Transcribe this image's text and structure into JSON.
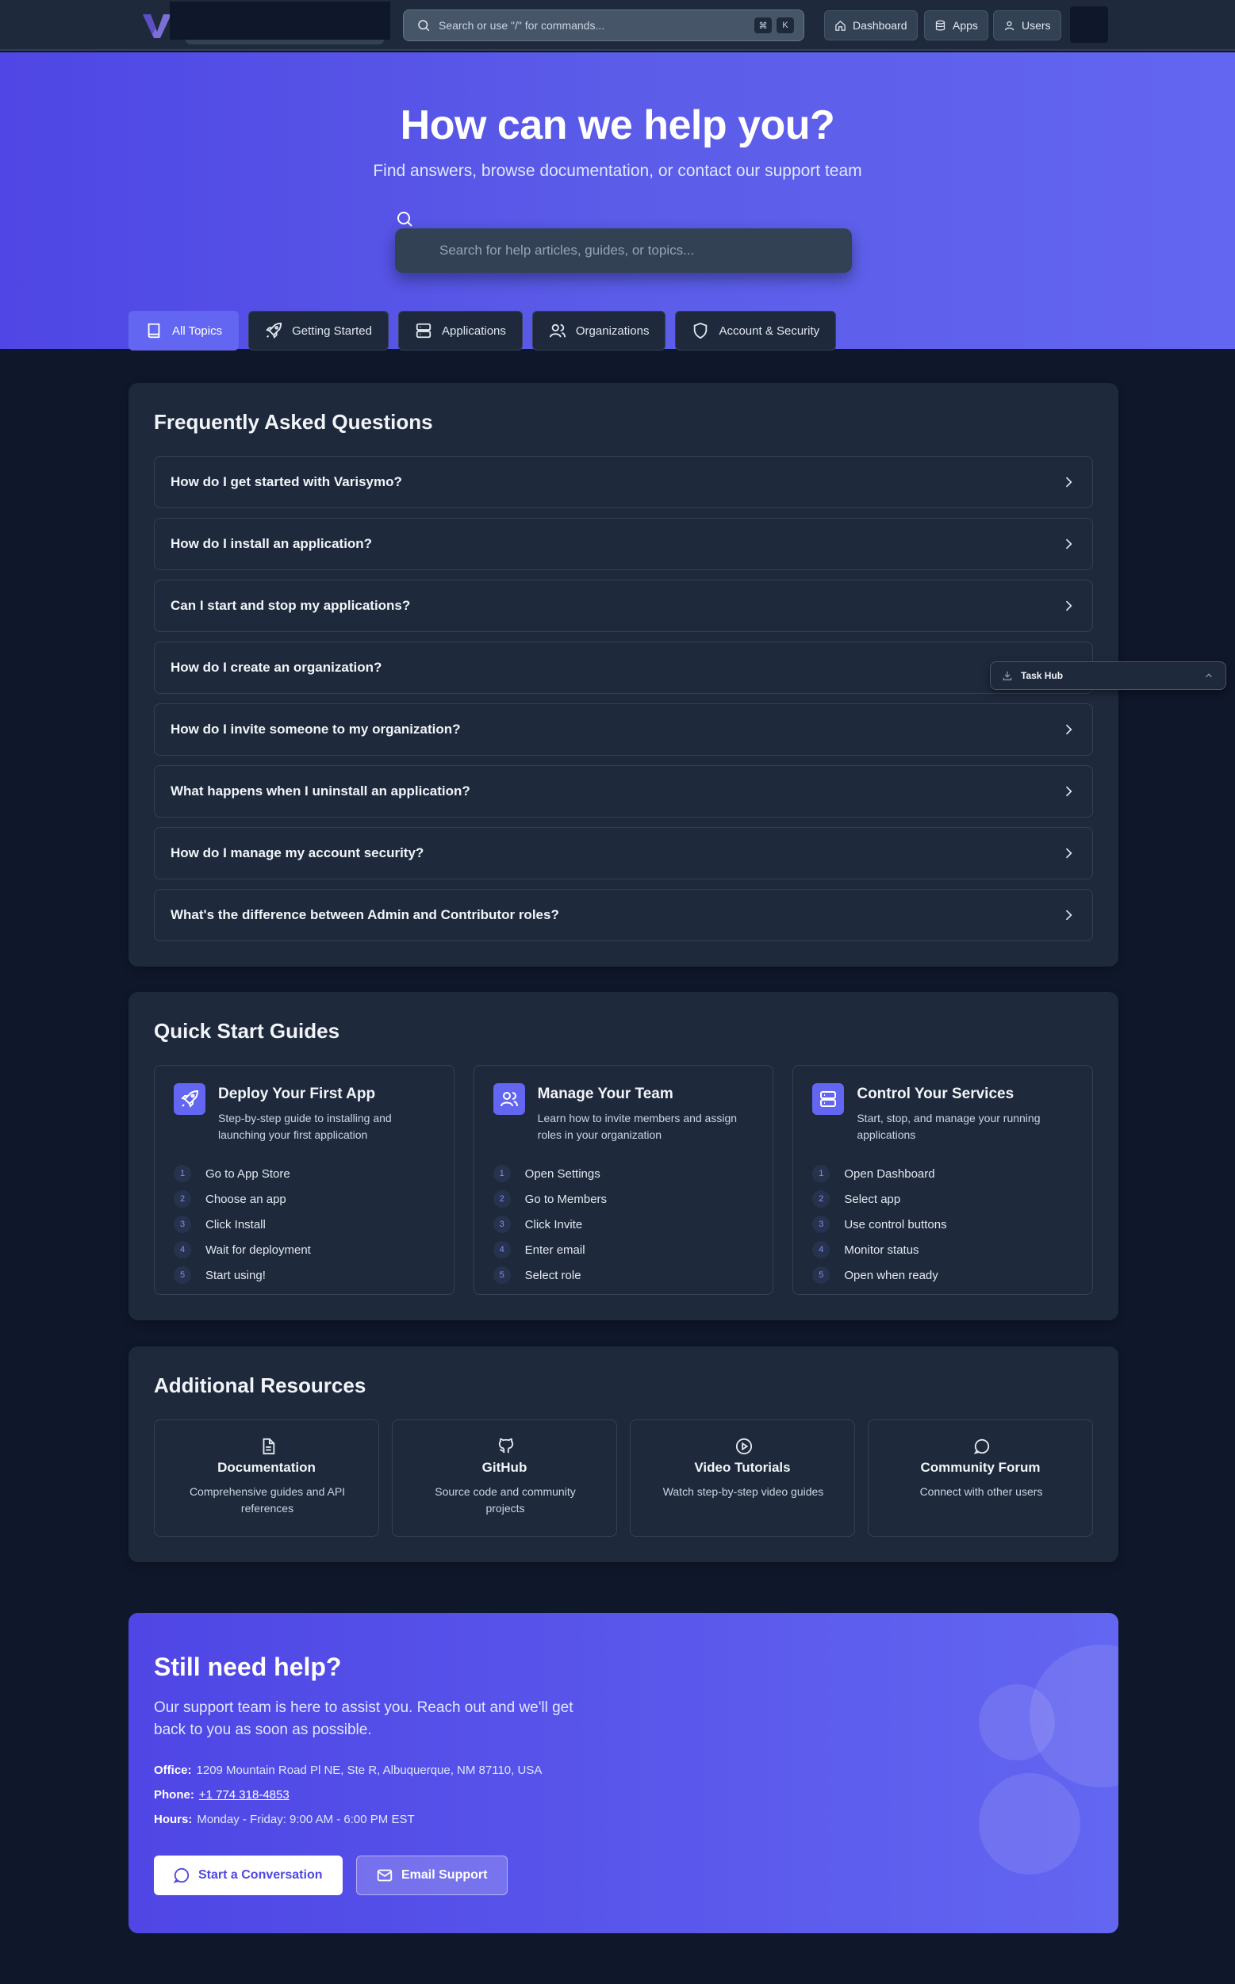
{
  "topbar": {
    "search_placeholder": "Search or use \"/\" for commands...",
    "shortcut_keys": [
      "⌘",
      "K"
    ],
    "nav": [
      {
        "label": "Dashboard",
        "icon": "home-icon"
      },
      {
        "label": "Apps",
        "icon": "database-icon"
      },
      {
        "label": "Users",
        "icon": "user-icon"
      }
    ]
  },
  "hero": {
    "title": "How can we help you?",
    "subtitle": "Find answers, browse documentation, or contact our support team",
    "search_placeholder": "Search for help articles, guides, or topics...",
    "tabs": [
      {
        "label": "All Topics",
        "icon": "book-icon",
        "active": true
      },
      {
        "label": "Getting Started",
        "icon": "rocket-icon",
        "active": false
      },
      {
        "label": "Applications",
        "icon": "server-icon",
        "active": false
      },
      {
        "label": "Organizations",
        "icon": "users-icon",
        "active": false
      },
      {
        "label": "Account & Security",
        "icon": "shield-icon",
        "active": false
      }
    ]
  },
  "faq": {
    "title": "Frequently Asked Questions",
    "items": [
      "How do I get started with Varisymo?",
      "How do I install an application?",
      "Can I start and stop my applications?",
      "How do I create an organization?",
      "How do I invite someone to my organization?",
      "What happens when I uninstall an application?",
      "How do I manage my account security?",
      "What's the difference between Admin and Contributor roles?"
    ]
  },
  "guides": {
    "title": "Quick Start Guides",
    "items": [
      {
        "title": "Deploy Your First App",
        "description": "Step-by-step guide to installing and launching your first application",
        "icon": "rocket-icon",
        "steps": [
          "Go to App Store",
          "Choose an app",
          "Click Install",
          "Wait for deployment",
          "Start using!"
        ]
      },
      {
        "title": "Manage Your Team",
        "description": "Learn how to invite members and assign roles in your organization",
        "icon": "users-icon",
        "steps": [
          "Open Settings",
          "Go to Members",
          "Click Invite",
          "Enter email",
          "Select role"
        ]
      },
      {
        "title": "Control Your Services",
        "description": "Start, stop, and manage your running applications",
        "icon": "server-icon",
        "steps": [
          "Open Dashboard",
          "Select app",
          "Use control buttons",
          "Monitor status",
          "Open when ready"
        ]
      }
    ]
  },
  "resources": {
    "title": "Additional Resources",
    "items": [
      {
        "title": "Documentation",
        "description": "Comprehensive guides and API references",
        "icon": "file-text-icon"
      },
      {
        "title": "GitHub",
        "description": "Source code and community projects",
        "icon": "github-icon"
      },
      {
        "title": "Video Tutorials",
        "description": "Watch step-by-step video guides",
        "icon": "play-circle-icon"
      },
      {
        "title": "Community Forum",
        "description": "Connect with other users",
        "icon": "chat-bubble-icon"
      }
    ]
  },
  "help": {
    "title": "Still need help?",
    "lead": "Our support team is here to assist you. Reach out and we'll get back to you as soon as possible.",
    "office_label": "Office:",
    "office": "1209 Mountain Road Pl NE, Ste R, Albuquerque, NM 87110, USA",
    "phone_label": "Phone:",
    "phone": "+1 774 318-4853",
    "hours_label": "Hours:",
    "hours": "Monday - Friday: 9:00 AM - 6:00 PM EST",
    "primary_button": "Start a Conversation",
    "secondary_button": "Email Support"
  },
  "taskhub": {
    "label": "Task Hub"
  },
  "colors": {
    "accent": "#6366f1",
    "background": "#0f172a",
    "card": "#1e293b",
    "border": "#334155"
  }
}
